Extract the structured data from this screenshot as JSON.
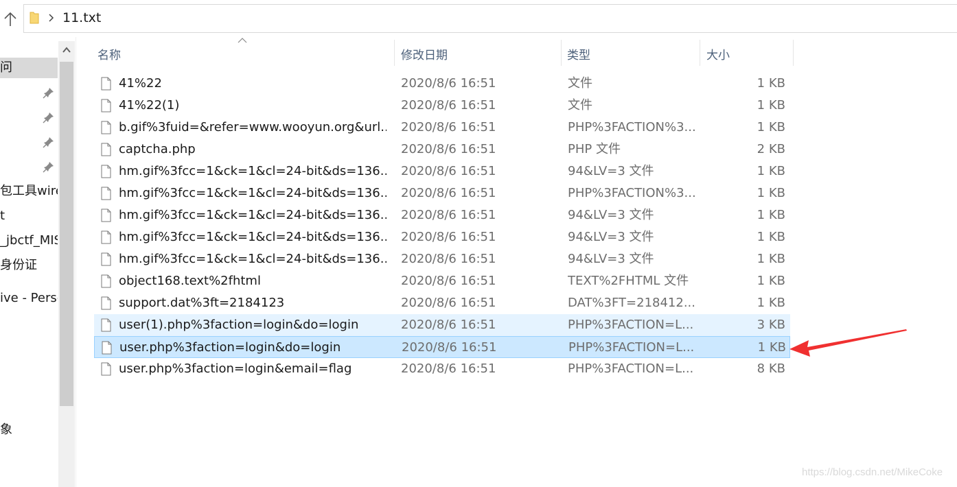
{
  "address_bar": {
    "path": "11.txt"
  },
  "nav": {
    "items": [
      {
        "label": "问",
        "selected": true
      },
      {
        "label": "",
        "pinned": true
      },
      {
        "label": "",
        "pinned": true
      },
      {
        "label": "",
        "pinned": true
      },
      {
        "label": "",
        "pinned": true
      },
      {
        "label": "包工具wireshark"
      },
      {
        "label": "t"
      },
      {
        "label": "_jbctf_MISC"
      },
      {
        "label": "身份证"
      },
      {
        "label": "ive - Personal"
      },
      {
        "label": "象"
      }
    ]
  },
  "columns": {
    "name": "名称",
    "date": "修改日期",
    "type": "类型",
    "size": "大小"
  },
  "files": [
    {
      "name": "41%22",
      "date": "2020/8/6 16:51",
      "type": "文件",
      "size": "1 KB",
      "state": ""
    },
    {
      "name": "41%22(1)",
      "date": "2020/8/6 16:51",
      "type": "文件",
      "size": "1 KB",
      "state": ""
    },
    {
      "name": "b.gif%3fuid=&refer=www.wooyun.org&url...",
      "date": "2020/8/6 16:51",
      "type": "PHP%3FACTION%3...",
      "size": "1 KB",
      "state": ""
    },
    {
      "name": "captcha.php",
      "date": "2020/8/6 16:51",
      "type": "PHP 文件",
      "size": "2 KB",
      "state": ""
    },
    {
      "name": "hm.gif%3fcc=1&ck=1&cl=24-bit&ds=136...",
      "date": "2020/8/6 16:51",
      "type": "94&LV=3 文件",
      "size": "1 KB",
      "state": ""
    },
    {
      "name": "hm.gif%3fcc=1&ck=1&cl=24-bit&ds=136...",
      "date": "2020/8/6 16:51",
      "type": "PHP%3FACTION%3...",
      "size": "1 KB",
      "state": ""
    },
    {
      "name": "hm.gif%3fcc=1&ck=1&cl=24-bit&ds=136...",
      "date": "2020/8/6 16:51",
      "type": "94&LV=3 文件",
      "size": "1 KB",
      "state": ""
    },
    {
      "name": "hm.gif%3fcc=1&ck=1&cl=24-bit&ds=136...",
      "date": "2020/8/6 16:51",
      "type": "94&LV=3 文件",
      "size": "1 KB",
      "state": ""
    },
    {
      "name": "hm.gif%3fcc=1&ck=1&cl=24-bit&ds=136...",
      "date": "2020/8/6 16:51",
      "type": "94&LV=3 文件",
      "size": "1 KB",
      "state": ""
    },
    {
      "name": "object168.text%2fhtml",
      "date": "2020/8/6 16:51",
      "type": "TEXT%2FHTML 文件",
      "size": "1 KB",
      "state": ""
    },
    {
      "name": "support.dat%3ft=2184123",
      "date": "2020/8/6 16:51",
      "type": "DAT%3FT=218412...",
      "size": "1 KB",
      "state": ""
    },
    {
      "name": "user(1).php%3faction=login&do=login",
      "date": "2020/8/6 16:51",
      "type": "PHP%3FACTION=L...",
      "size": "3 KB",
      "state": "hover"
    },
    {
      "name": "user.php%3faction=login&do=login",
      "date": "2020/8/6 16:51",
      "type": "PHP%3FACTION=L...",
      "size": "1 KB",
      "state": "selected"
    },
    {
      "name": "user.php%3faction=login&email=flag",
      "date": "2020/8/6 16:51",
      "type": "PHP%3FACTION=L...",
      "size": "8 KB",
      "state": ""
    }
  ],
  "colors": {
    "selected_row": "#cce8ff",
    "hover_row": "#e5f3ff",
    "arrow": "#f03030"
  },
  "watermark": "https://blog.csdn.net/MikeCoke"
}
